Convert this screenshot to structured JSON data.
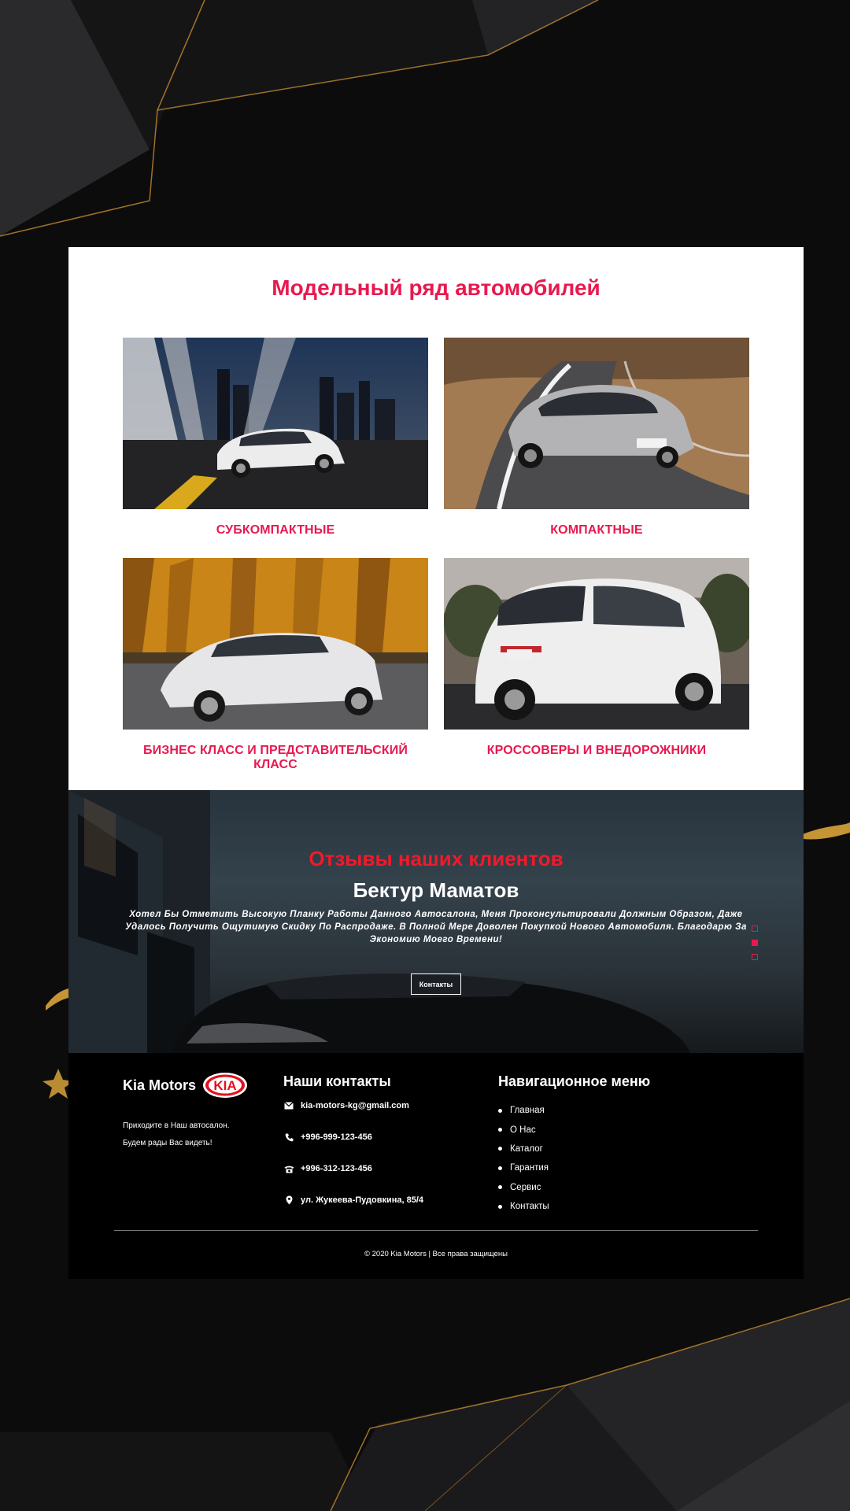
{
  "models": {
    "title": "Модельный ряд автомобилей",
    "cards": [
      {
        "label": "СУБКОМПАКТНЫЕ"
      },
      {
        "label": "КОМПАКТНЫЕ"
      },
      {
        "label": "БИЗНЕС КЛАСС И ПРЕДСТАВИТЕЛЬСКИЙ КЛАСС"
      },
      {
        "label": "КРОССОВЕРЫ И ВНЕДОРОЖНИКИ"
      }
    ]
  },
  "reviews": {
    "heading": "Отзывы наших клиентов",
    "name": "Бектур Маматов",
    "text": "Хотел Бы Отметить Высокую Планку Работы Данного Автосалона, Меня Проконсультировали Должным Образом, Даже Удалось Получить Ощутимую Скидку По Распродаже. В Полной Мере Доволен Покупкой Нового Автомобиля. Благодарю За Экономию Моего Времени!",
    "button": "Контакты",
    "dots_active": 2
  },
  "footer": {
    "brand": "Kia Motors",
    "logo_text": "KIA",
    "brand_lines": [
      "Приходите в Наш автосалон.",
      "Будем рады Вас видеть!"
    ],
    "contacts_title": "Наши контакты",
    "email": "kia-motors-kg@gmail.com",
    "phone_mobile": "+996-999-123-456",
    "phone_office": "+996-312-123-456",
    "address": "ул. Жукеева-Пудовкина, 85/4",
    "nav_title": "Навигационное меню",
    "nav": [
      "Главная",
      "О Нас",
      "Каталог",
      "Гарантия",
      "Сервис",
      "Контакты"
    ],
    "copyright": "© 2020 Kia Motors | Все права защищены"
  },
  "colors": {
    "accent": "#e8194f",
    "review_heading": "#f01a2a",
    "background": "#0b0b0c"
  },
  "icons": [
    "envelope-icon",
    "phone-icon",
    "office-phone-icon",
    "location-pin-icon",
    "kia-logo"
  ]
}
